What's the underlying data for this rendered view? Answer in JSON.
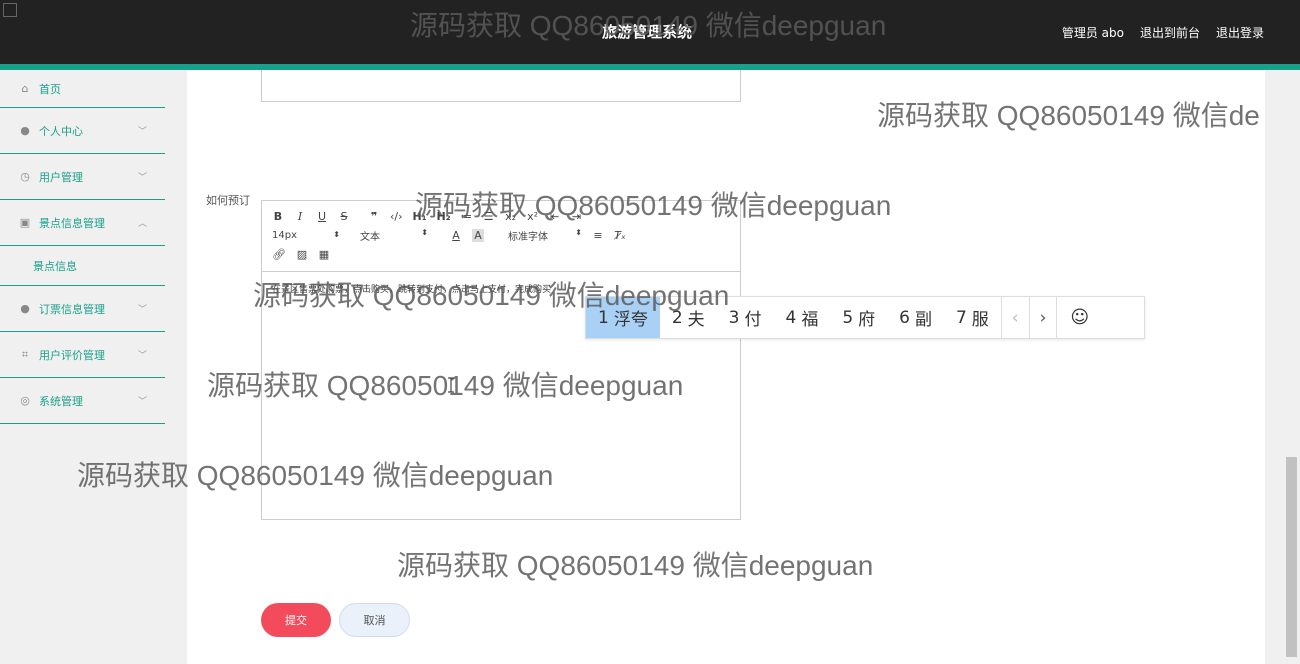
{
  "header": {
    "title": "旅游管理系统",
    "links": [
      "管理员 abo",
      "退出到前台",
      "退出登录"
    ]
  },
  "sidebar": {
    "items": [
      {
        "label": "首页",
        "icon": "home-icon"
      },
      {
        "label": "个人中心",
        "icon": "user-icon"
      },
      {
        "label": "用户管理",
        "icon": "clock-icon"
      },
      {
        "label": "景点信息管理",
        "icon": "clipboard-icon"
      },
      {
        "label": "订票信息管理",
        "icon": "bulb-icon"
      },
      {
        "label": "用户评价管理",
        "icon": "crop-icon"
      },
      {
        "label": "系统管理",
        "icon": "compass-icon"
      }
    ],
    "subitem": "景点信息"
  },
  "form": {
    "field_label": "如何预订",
    "editor_toolbar": {
      "font_size": "14px",
      "block_type": "文本",
      "font_family": "标准字体"
    },
    "editor_text": "在景区售票处购票，点击购买，跳转到支付，点击马上支付，完成购买"
  },
  "ime": {
    "candidates": [
      {
        "num": "1",
        "text": "浮夸"
      },
      {
        "num": "2",
        "text": "夫"
      },
      {
        "num": "3",
        "text": "付"
      },
      {
        "num": "4",
        "text": "福"
      },
      {
        "num": "5",
        "text": "府"
      },
      {
        "num": "6",
        "text": "副"
      },
      {
        "num": "7",
        "text": "服"
      }
    ],
    "prev": "‹",
    "next": "›",
    "emoji": "☺"
  },
  "buttons": {
    "submit": "提交",
    "cancel": "取消"
  },
  "watermark": "源码获取 QQ86050149 微信deepguan",
  "watermark_cut": "源码获取 QQ86050149 微信de",
  "colors": {
    "accent": "#1a9f8c",
    "submit": "#f44b5c",
    "topbar": "#222222"
  }
}
